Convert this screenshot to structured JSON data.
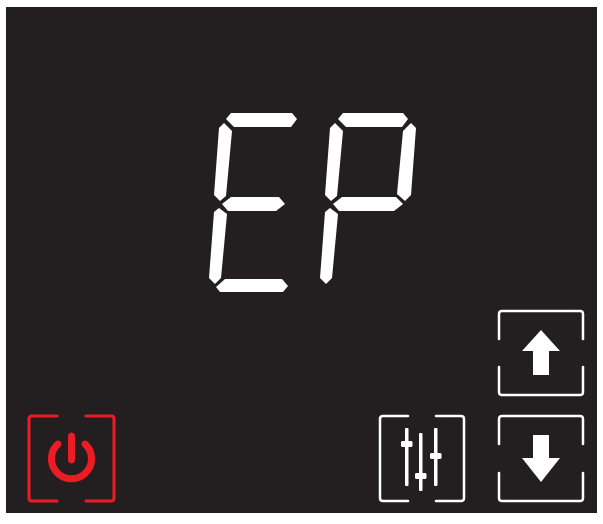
{
  "display": {
    "code": "EP"
  },
  "controls": {
    "power": {
      "icon": "power-icon"
    },
    "settings": {
      "icon": "sliders-icon"
    },
    "up": {
      "icon": "arrow-up-icon"
    },
    "down": {
      "icon": "arrow-down-icon"
    }
  },
  "colors": {
    "panel": "#231f20",
    "segment": "#ffffff",
    "power_accent": "#ed1c24",
    "button_outline": "#ffffff"
  }
}
